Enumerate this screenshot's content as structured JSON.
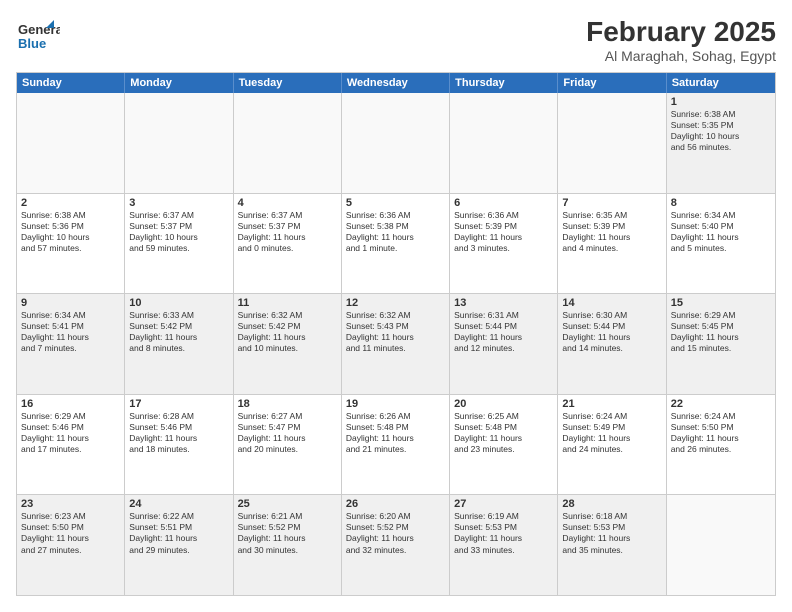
{
  "header": {
    "logo_line1": "General",
    "logo_line2": "Blue",
    "month_title": "February 2025",
    "subtitle": "Al Maraghah, Sohag, Egypt"
  },
  "weekdays": [
    "Sunday",
    "Monday",
    "Tuesday",
    "Wednesday",
    "Thursday",
    "Friday",
    "Saturday"
  ],
  "rows": [
    [
      {
        "day": "",
        "text": ""
      },
      {
        "day": "",
        "text": ""
      },
      {
        "day": "",
        "text": ""
      },
      {
        "day": "",
        "text": ""
      },
      {
        "day": "",
        "text": ""
      },
      {
        "day": "",
        "text": ""
      },
      {
        "day": "1",
        "text": "Sunrise: 6:38 AM\nSunset: 5:35 PM\nDaylight: 10 hours\nand 56 minutes."
      }
    ],
    [
      {
        "day": "2",
        "text": "Sunrise: 6:38 AM\nSunset: 5:36 PM\nDaylight: 10 hours\nand 57 minutes."
      },
      {
        "day": "3",
        "text": "Sunrise: 6:37 AM\nSunset: 5:37 PM\nDaylight: 10 hours\nand 59 minutes."
      },
      {
        "day": "4",
        "text": "Sunrise: 6:37 AM\nSunset: 5:37 PM\nDaylight: 11 hours\nand 0 minutes."
      },
      {
        "day": "5",
        "text": "Sunrise: 6:36 AM\nSunset: 5:38 PM\nDaylight: 11 hours\nand 1 minute."
      },
      {
        "day": "6",
        "text": "Sunrise: 6:36 AM\nSunset: 5:39 PM\nDaylight: 11 hours\nand 3 minutes."
      },
      {
        "day": "7",
        "text": "Sunrise: 6:35 AM\nSunset: 5:39 PM\nDaylight: 11 hours\nand 4 minutes."
      },
      {
        "day": "8",
        "text": "Sunrise: 6:34 AM\nSunset: 5:40 PM\nDaylight: 11 hours\nand 5 minutes."
      }
    ],
    [
      {
        "day": "9",
        "text": "Sunrise: 6:34 AM\nSunset: 5:41 PM\nDaylight: 11 hours\nand 7 minutes."
      },
      {
        "day": "10",
        "text": "Sunrise: 6:33 AM\nSunset: 5:42 PM\nDaylight: 11 hours\nand 8 minutes."
      },
      {
        "day": "11",
        "text": "Sunrise: 6:32 AM\nSunset: 5:42 PM\nDaylight: 11 hours\nand 10 minutes."
      },
      {
        "day": "12",
        "text": "Sunrise: 6:32 AM\nSunset: 5:43 PM\nDaylight: 11 hours\nand 11 minutes."
      },
      {
        "day": "13",
        "text": "Sunrise: 6:31 AM\nSunset: 5:44 PM\nDaylight: 11 hours\nand 12 minutes."
      },
      {
        "day": "14",
        "text": "Sunrise: 6:30 AM\nSunset: 5:44 PM\nDaylight: 11 hours\nand 14 minutes."
      },
      {
        "day": "15",
        "text": "Sunrise: 6:29 AM\nSunset: 5:45 PM\nDaylight: 11 hours\nand 15 minutes."
      }
    ],
    [
      {
        "day": "16",
        "text": "Sunrise: 6:29 AM\nSunset: 5:46 PM\nDaylight: 11 hours\nand 17 minutes."
      },
      {
        "day": "17",
        "text": "Sunrise: 6:28 AM\nSunset: 5:46 PM\nDaylight: 11 hours\nand 18 minutes."
      },
      {
        "day": "18",
        "text": "Sunrise: 6:27 AM\nSunset: 5:47 PM\nDaylight: 11 hours\nand 20 minutes."
      },
      {
        "day": "19",
        "text": "Sunrise: 6:26 AM\nSunset: 5:48 PM\nDaylight: 11 hours\nand 21 minutes."
      },
      {
        "day": "20",
        "text": "Sunrise: 6:25 AM\nSunset: 5:48 PM\nDaylight: 11 hours\nand 23 minutes."
      },
      {
        "day": "21",
        "text": "Sunrise: 6:24 AM\nSunset: 5:49 PM\nDaylight: 11 hours\nand 24 minutes."
      },
      {
        "day": "22",
        "text": "Sunrise: 6:24 AM\nSunset: 5:50 PM\nDaylight: 11 hours\nand 26 minutes."
      }
    ],
    [
      {
        "day": "23",
        "text": "Sunrise: 6:23 AM\nSunset: 5:50 PM\nDaylight: 11 hours\nand 27 minutes."
      },
      {
        "day": "24",
        "text": "Sunrise: 6:22 AM\nSunset: 5:51 PM\nDaylight: 11 hours\nand 29 minutes."
      },
      {
        "day": "25",
        "text": "Sunrise: 6:21 AM\nSunset: 5:52 PM\nDaylight: 11 hours\nand 30 minutes."
      },
      {
        "day": "26",
        "text": "Sunrise: 6:20 AM\nSunset: 5:52 PM\nDaylight: 11 hours\nand 32 minutes."
      },
      {
        "day": "27",
        "text": "Sunrise: 6:19 AM\nSunset: 5:53 PM\nDaylight: 11 hours\nand 33 minutes."
      },
      {
        "day": "28",
        "text": "Sunrise: 6:18 AM\nSunset: 5:53 PM\nDaylight: 11 hours\nand 35 minutes."
      },
      {
        "day": "",
        "text": ""
      }
    ]
  ],
  "colors": {
    "header_bg": "#2a6ebb",
    "shaded_row": "#f0f0f0"
  }
}
